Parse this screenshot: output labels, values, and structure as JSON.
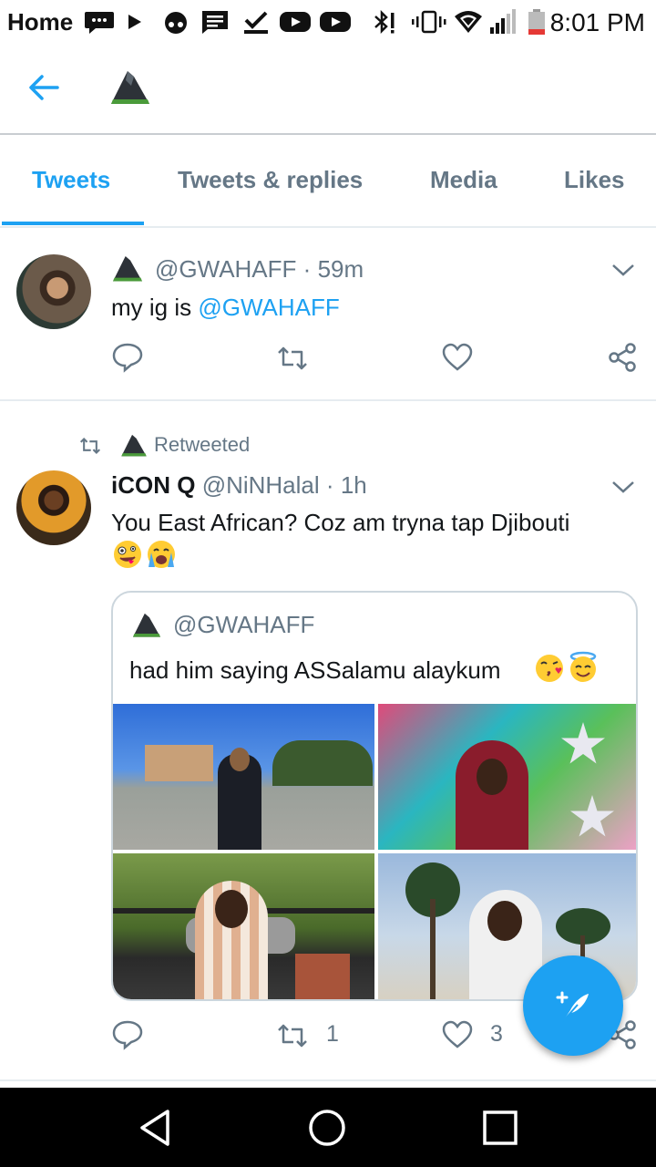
{
  "status_bar": {
    "carrier_label": "Home",
    "time": "8:01 PM",
    "icons": [
      "chat-icon",
      "play-icon",
      "notification-icon",
      "message-icon",
      "check-icon",
      "youtube-icon",
      "youtube-icon",
      "bluetooth-icon",
      "vibrate-icon",
      "wifi-icon",
      "signal-icon",
      "battery-icon"
    ],
    "battery_color": "#e53935"
  },
  "header": {
    "back_icon": "back-arrow-icon",
    "profile_icon": "mountain-icon"
  },
  "tabs": [
    {
      "label": "Tweets",
      "active": true
    },
    {
      "label": "Tweets & replies",
      "active": false
    },
    {
      "label": "Media",
      "active": false
    },
    {
      "label": "Likes",
      "active": false
    }
  ],
  "tweet1": {
    "handle": "@GWAHAFF",
    "separator": "·",
    "time": "59m",
    "text_prefix": "my ig is ",
    "text_link": "@GWAHAFF"
  },
  "tweet2": {
    "retweet_label": "Retweeted",
    "display_name": "iCON Q",
    "handle": "@NiNHalal",
    "separator": "·",
    "time": "1h",
    "text": "You East African? Coz am tryna tap Djibouti",
    "emojis": [
      "zany-face-emoji",
      "crying-face-emoji"
    ],
    "quote": {
      "handle": "@GWAHAFF",
      "text": "had him saying ASSalamu alaykum",
      "emojis": [
        "kiss-face-emoji",
        "halo-face-emoji"
      ],
      "photos": [
        "photo-parking-lot",
        "photo-mural-wall",
        "photo-grill-patio",
        "photo-beach-palms"
      ]
    },
    "retweet_count": "1",
    "like_count": "3"
  },
  "colors": {
    "accent": "#1da1f2",
    "secondary_text": "#657786",
    "divider": "#e6ecf0"
  }
}
